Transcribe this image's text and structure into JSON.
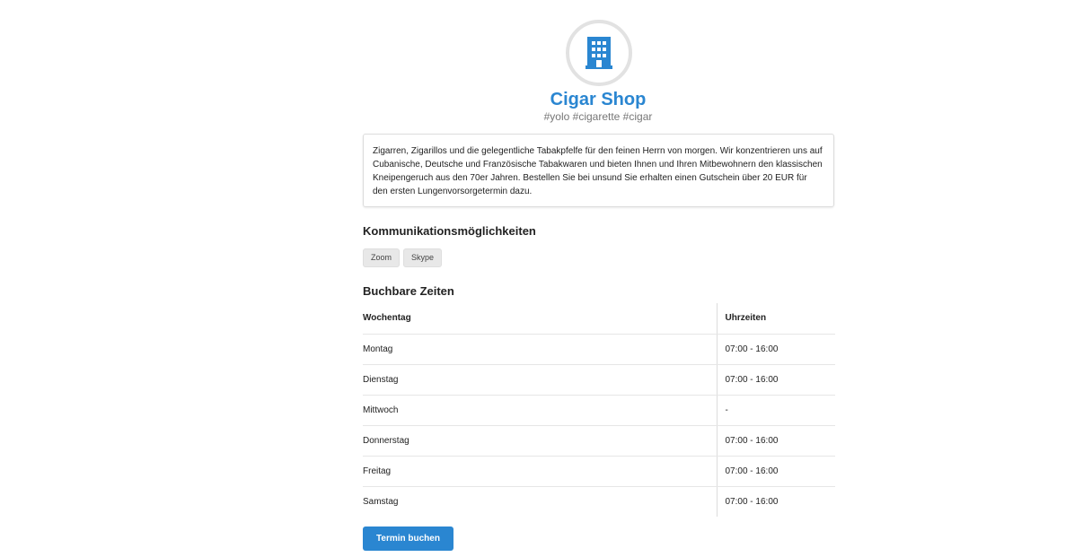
{
  "shop": {
    "icon": "building-icon",
    "accent_color": "#2a86d1",
    "name": "Cigar Shop",
    "tags": "#yolo #cigarette #cigar",
    "description": "Zigarren, Zigarillos und die gelegentliche Tabakpfelfe für den feinen Herrn von morgen. Wir konzentrieren uns auf Cubanische, Deutsche und Französische Tabakwaren und bieten Ihnen und Ihren Mitbewohnern den klassischen Kneipengeruch aus den 70er Jahren. Bestellen Sie bei unsund Sie erhalten einen Gutschein über 20 EUR für den ersten Lungenvorsorgetermin dazu."
  },
  "communication": {
    "heading": "Kommunikationsmöglichkeiten",
    "options": [
      "Zoom",
      "Skype"
    ]
  },
  "times": {
    "heading": "Buchbare Zeiten",
    "columns": [
      "Wochentag",
      "Uhrzeiten"
    ],
    "rows": [
      [
        "Montag",
        "07:00 - 16:00"
      ],
      [
        "Dienstag",
        "07:00 - 16:00"
      ],
      [
        "Mittwoch",
        "-"
      ],
      [
        "Donnerstag",
        "07:00 - 16:00"
      ],
      [
        "Freitag",
        "07:00 - 16:00"
      ],
      [
        "Samstag",
        "07:00 - 16:00"
      ]
    ]
  },
  "book_button_label": "Termin buchen"
}
